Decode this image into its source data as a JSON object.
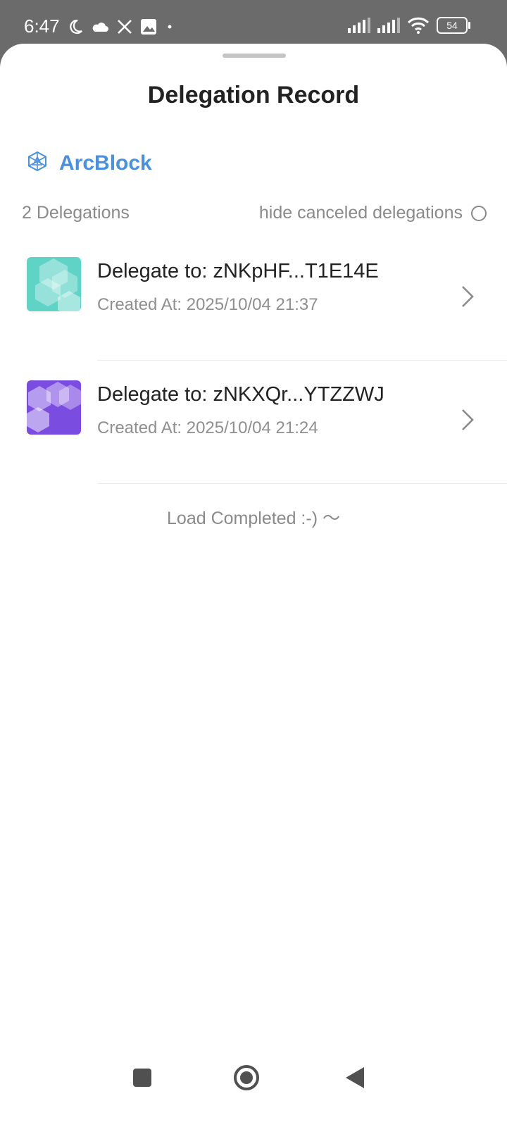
{
  "status_bar": {
    "time": "6:47",
    "battery": "54",
    "icons_left": [
      "moon-icon",
      "cloud-icon",
      "x-icon",
      "gallery-icon",
      "dot-icon"
    ],
    "icons_right": [
      "signal-icon",
      "signal-icon",
      "wifi-icon",
      "battery-icon"
    ]
  },
  "header": {
    "title": "Delegation Record"
  },
  "brand": {
    "name": "ArcBlock",
    "color": "#4a90e2",
    "icon": "arcblock-logo-icon"
  },
  "summary": {
    "count_label": "2 Delegations",
    "hide_label": "hide canceled delegations"
  },
  "delegations": [
    {
      "title": "Delegate to: zNKpHF...T1E14E",
      "created": "Created At: 2025/10/04 21:37",
      "avatar_color": "#5fd3c6"
    },
    {
      "title": "Delegate to: zNKXQr...YTZZWJ",
      "created": "Created At: 2025/10/04 21:24",
      "avatar_color": "#7b4ce0"
    }
  ],
  "footer": {
    "load_status": "Load Completed :-) ～"
  },
  "navbar": {
    "icons": [
      "recents-square-icon",
      "home-circle-icon",
      "back-triangle-icon"
    ]
  }
}
